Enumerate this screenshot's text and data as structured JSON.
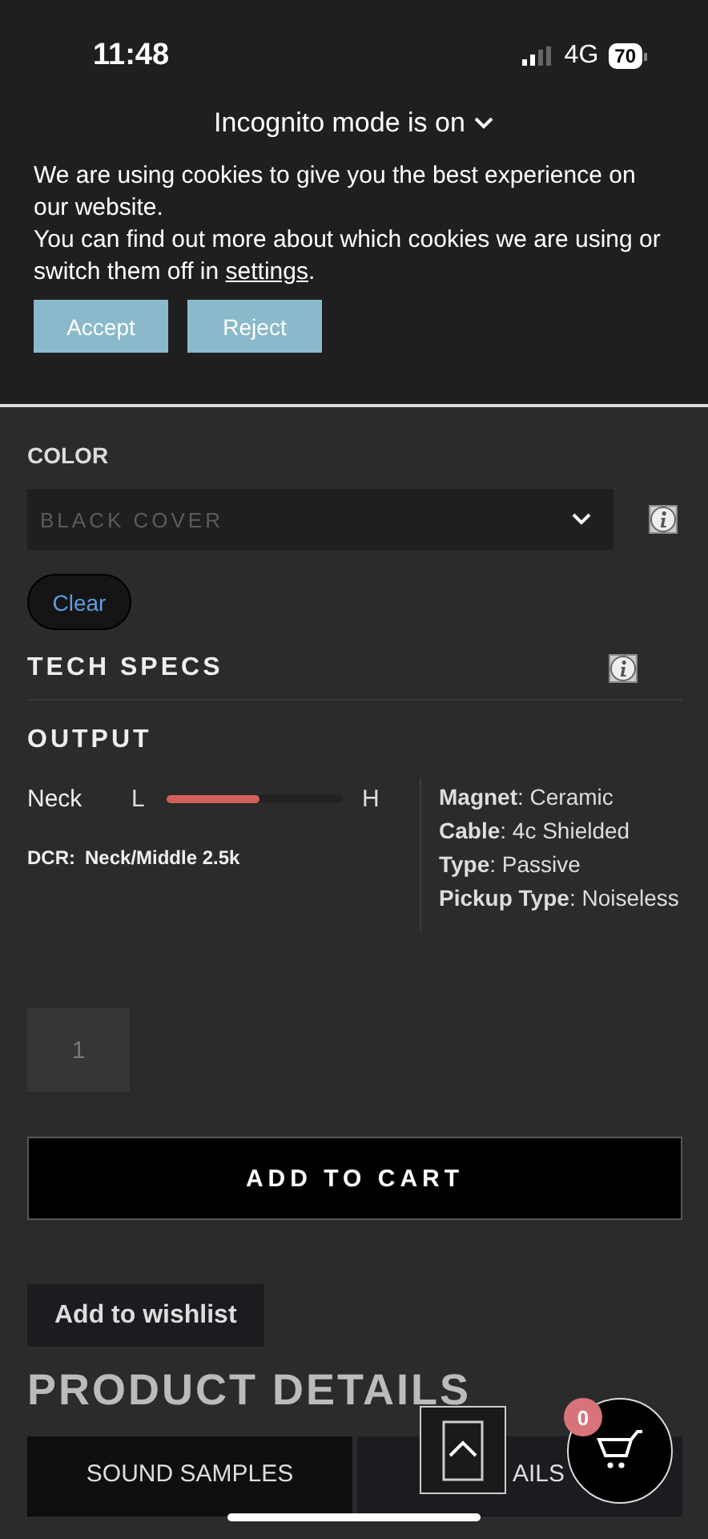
{
  "status_bar": {
    "time": "11:48",
    "network": "4G",
    "battery": "70"
  },
  "incognito": {
    "label": "Incognito mode is on"
  },
  "cookie_banner": {
    "message": "We are using cookies to give you the best experience on our website.",
    "details": "You can find out more about which cookies we are using or switch them off in",
    "link": "settings",
    "end": ".",
    "buttons": [
      "Accept",
      "Reject"
    ]
  },
  "color_option": {
    "label": "COLOR",
    "select_value": "BLACK COVER",
    "clear": "Clear"
  },
  "tech_specs": {
    "title": "TECH SPECS"
  },
  "output": {
    "title": "OUTPUT",
    "meter": {
      "position": "Neck",
      "low": "L",
      "high": "H",
      "level": 0.53
    },
    "dcr_label": "DCR:",
    "dcr_value": "Neck/Middle 2.5k",
    "specs": [
      "**Magnet**: Ceramic",
      "**Cable**: 4c Shielded",
      "**Type**: Passive",
      "**Pickup Type**: Noiseless"
    ]
  },
  "quantity": "1",
  "add_to_cart": "ADD TO CART",
  "wishlist": "Add to wishlist",
  "product_details": {
    "title": "PRODUCT DETAILS",
    "tabs": [
      {
        "label": "SOUND SAMPLES",
        "selected": true
      },
      {
        "label": "AILS",
        "selected": false
      }
    ]
  },
  "cart": {
    "count": "0"
  }
}
